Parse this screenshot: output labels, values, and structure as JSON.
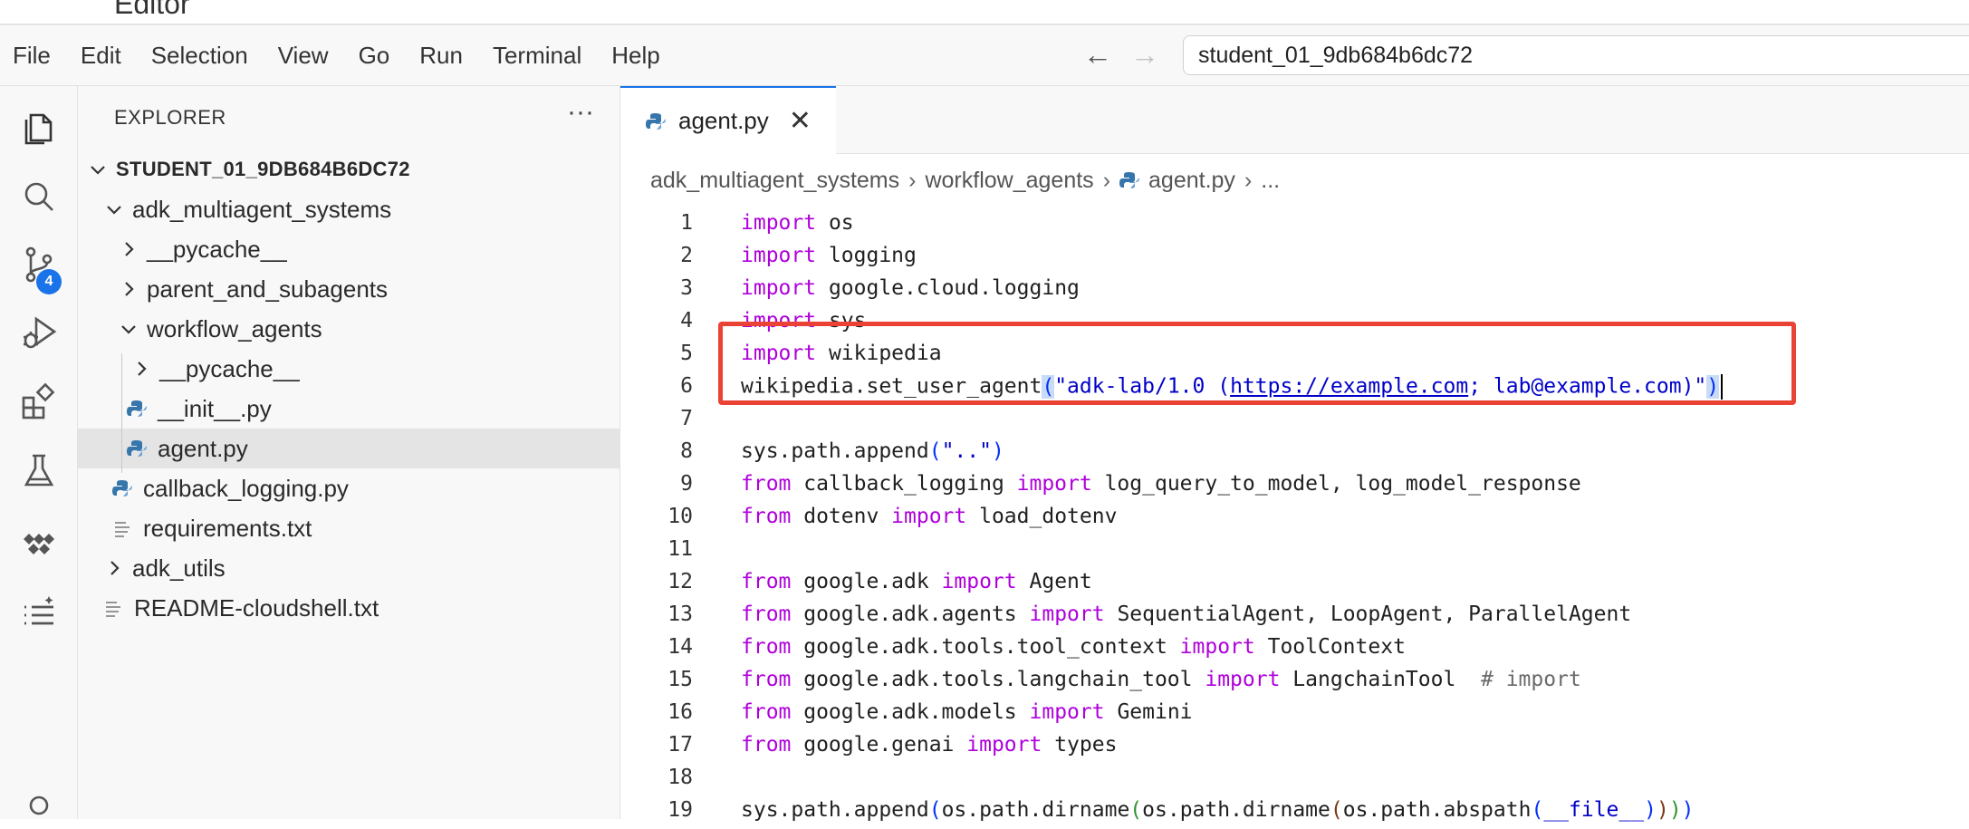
{
  "topbar": {
    "title": "Editor"
  },
  "menu": [
    "File",
    "Edit",
    "Selection",
    "View",
    "Go",
    "Run",
    "Terminal",
    "Help"
  ],
  "search": {
    "value": "student_01_9db684b6dc72"
  },
  "activitybar": {
    "icons": [
      "explorer-icon",
      "search-icon",
      "source-control-icon",
      "run-debug-icon",
      "extensions-icon",
      "testing-icon",
      "cloud-code-icon",
      "outline-icon"
    ],
    "source_control_badge": "4"
  },
  "sidebar": {
    "title": "EXPLORER",
    "more": "···",
    "tree": [
      {
        "label": "STUDENT_01_9DB684B6DC72",
        "type": "root",
        "expanded": true
      },
      {
        "label": "adk_multiagent_systems",
        "type": "folder",
        "expanded": true
      },
      {
        "label": "__pycache__",
        "type": "folder",
        "expanded": false
      },
      {
        "label": "parent_and_subagents",
        "type": "folder",
        "expanded": false
      },
      {
        "label": "workflow_agents",
        "type": "folder",
        "expanded": true
      },
      {
        "label": "__pycache__",
        "type": "folder",
        "expanded": false
      },
      {
        "label": "__init__.py",
        "type": "python"
      },
      {
        "label": "agent.py",
        "type": "python",
        "selected": true
      },
      {
        "label": "callback_logging.py",
        "type": "python"
      },
      {
        "label": "requirements.txt",
        "type": "text"
      },
      {
        "label": "adk_utils",
        "type": "folder",
        "expanded": false
      },
      {
        "label": "README-cloudshell.txt",
        "type": "text"
      }
    ]
  },
  "editor": {
    "tab": {
      "label": "agent.py",
      "close": "✕"
    },
    "breadcrumb": [
      "adk_multiagent_systems",
      "workflow_agents",
      "agent.py",
      "..."
    ],
    "breadcrumb_sep": "›",
    "lines": [
      {
        "n": "1",
        "parts": [
          {
            "t": "import",
            "c": "kw"
          },
          {
            "t": " os"
          }
        ]
      },
      {
        "n": "2",
        "parts": [
          {
            "t": "import",
            "c": "kw"
          },
          {
            "t": " logging"
          }
        ]
      },
      {
        "n": "3",
        "parts": [
          {
            "t": "import",
            "c": "kw"
          },
          {
            "t": " google.cloud.logging"
          }
        ]
      },
      {
        "n": "4",
        "parts": [
          {
            "t": "import",
            "c": "kw"
          },
          {
            "t": " sys"
          }
        ]
      },
      {
        "n": "5",
        "parts": [
          {
            "t": "import",
            "c": "kw"
          },
          {
            "t": " wikipedia"
          }
        ]
      },
      {
        "n": "6",
        "parts": [
          {
            "t": "wikipedia.set_user_agent"
          },
          {
            "t": "(",
            "c": "p1 hilite"
          },
          {
            "t": "\"adk-lab/1.0 (",
            "c": "str"
          },
          {
            "t": "https://example.com",
            "c": "str url"
          },
          {
            "t": "; lab@example.com)\"",
            "c": "str"
          },
          {
            "t": ")",
            "c": "p1 hilite"
          },
          {
            "t": "",
            "c": "cursor"
          }
        ]
      },
      {
        "n": "7",
        "parts": []
      },
      {
        "n": "8",
        "parts": [
          {
            "t": "sys.path.append"
          },
          {
            "t": "(",
            "c": "p1"
          },
          {
            "t": "\"..\"",
            "c": "str"
          },
          {
            "t": ")",
            "c": "p1"
          }
        ]
      },
      {
        "n": "9",
        "parts": [
          {
            "t": "from",
            "c": "kw"
          },
          {
            "t": " callback_logging "
          },
          {
            "t": "import",
            "c": "kw"
          },
          {
            "t": " log_query_to_model, log_model_response"
          }
        ]
      },
      {
        "n": "10",
        "parts": [
          {
            "t": "from",
            "c": "kw"
          },
          {
            "t": " dotenv "
          },
          {
            "t": "import",
            "c": "kw"
          },
          {
            "t": " load_dotenv"
          }
        ]
      },
      {
        "n": "11",
        "parts": []
      },
      {
        "n": "12",
        "parts": [
          {
            "t": "from",
            "c": "kw"
          },
          {
            "t": " google.adk "
          },
          {
            "t": "import",
            "c": "kw"
          },
          {
            "t": " Agent"
          }
        ]
      },
      {
        "n": "13",
        "parts": [
          {
            "t": "from",
            "c": "kw"
          },
          {
            "t": " google.adk.agents "
          },
          {
            "t": "import",
            "c": "kw"
          },
          {
            "t": " SequentialAgent, LoopAgent, ParallelAgent"
          }
        ]
      },
      {
        "n": "14",
        "parts": [
          {
            "t": "from",
            "c": "kw"
          },
          {
            "t": " google.adk.tools.tool_context "
          },
          {
            "t": "import",
            "c": "kw"
          },
          {
            "t": " ToolContext"
          }
        ]
      },
      {
        "n": "15",
        "parts": [
          {
            "t": "from",
            "c": "kw"
          },
          {
            "t": " google.adk.tools.langchain_tool "
          },
          {
            "t": "import",
            "c": "kw"
          },
          {
            "t": " LangchainTool  "
          },
          {
            "t": "# import",
            "c": "cmt"
          }
        ]
      },
      {
        "n": "16",
        "parts": [
          {
            "t": "from",
            "c": "kw"
          },
          {
            "t": " google.adk.models "
          },
          {
            "t": "import",
            "c": "kw"
          },
          {
            "t": " Gemini"
          }
        ]
      },
      {
        "n": "17",
        "parts": [
          {
            "t": "from",
            "c": "kw"
          },
          {
            "t": " google.genai "
          },
          {
            "t": "import",
            "c": "kw"
          },
          {
            "t": " types"
          }
        ]
      },
      {
        "n": "18",
        "parts": []
      },
      {
        "n": "19",
        "parts": [
          {
            "t": "sys.path.append"
          },
          {
            "t": "(",
            "c": "p1"
          },
          {
            "t": "os.path.dirname"
          },
          {
            "t": "(",
            "c": "p2"
          },
          {
            "t": "os.path.dirname"
          },
          {
            "t": "(",
            "c": "p3"
          },
          {
            "t": "os.path.abspath"
          },
          {
            "t": "(",
            "c": "p1"
          },
          {
            "t": "__file__",
            "c": "dunder"
          },
          {
            "t": ")",
            "c": "p1"
          },
          {
            "t": ")",
            "c": "p3"
          },
          {
            "t": ")",
            "c": "p2"
          },
          {
            "t": ")",
            "c": "p1"
          }
        ]
      }
    ]
  },
  "colors": {
    "accent": "#1a73e8",
    "highlight_box": "#ea4335",
    "keyword": "#af00db",
    "string": "#0000c8"
  }
}
